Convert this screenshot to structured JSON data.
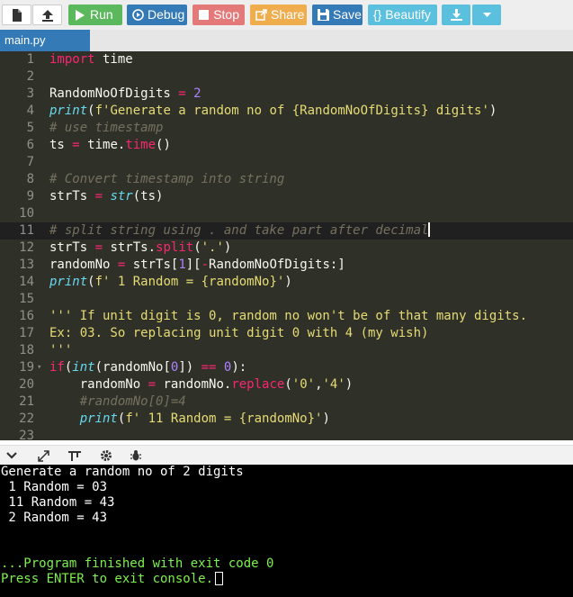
{
  "toolbar": {
    "new_icon": "file-icon",
    "open_icon": "upload-icon",
    "run_label": "Run",
    "debug_label": "Debug",
    "stop_label": "Stop",
    "share_label": "Share",
    "save_label": "Save",
    "beautify_label": "{} Beautify",
    "download_icon": "download-icon",
    "dropdown_icon": "caret-down-icon"
  },
  "tab": {
    "label": "main.py"
  },
  "editor": {
    "active_line": 11,
    "lines": [
      "import time",
      "",
      "RandomNoOfDigits = 2",
      "print(f'Generate a random no of {RandomNoOfDigits} digits')",
      "# use timestamp",
      "ts = time.time()",
      "",
      "# Convert timestamp into string",
      "strTs = str(ts)",
      "",
      "# split string using . and take part after decimal",
      "strTs = strTs.split('.')",
      "randomNo = strTs[1][-RandomNoOfDigits:]",
      "print(f' 1 Random = {randomNo}')",
      "",
      "''' If unit digit is 0, random no won't be of that many digits.",
      "Ex: 03. So replacing unit digit 0 with 4 (my wish)",
      "'''",
      "if(int(randomNo[0]) == 0):",
      "    randomNo = randomNo.replace('0','4')",
      "    #randomNo[0]=4",
      "    print(f' 11 Random = {randomNo}')",
      ""
    ]
  },
  "console_toolbar": {
    "icons": [
      "chevron-down-icon",
      "expand-icon",
      "input-icon",
      "gear-icon",
      "bug-icon"
    ]
  },
  "console": {
    "lines": [
      "Generate a random no of 2 digits",
      " 1 Random = 03",
      " 11 Random = 43",
      " 2 Random = 43",
      "",
      "",
      "...Program finished with exit code 0",
      "Press ENTER to exit console."
    ]
  },
  "colors": {
    "run": "#5cb85c",
    "debug": "#337ab7",
    "stop": "#e4797a",
    "share": "#f0ad4e",
    "save": "#337ab7",
    "beautify": "#5bc0de",
    "editor_bg": "#2f3129",
    "console_text_success": "#7cf04c"
  }
}
